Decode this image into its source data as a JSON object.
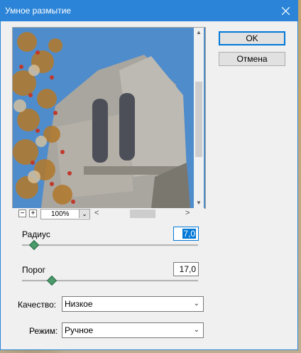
{
  "window": {
    "title": "Умное размытие"
  },
  "buttons": {
    "ok": "OK",
    "cancel": "Отмена"
  },
  "preview": {
    "zoom": "100%",
    "zoom_minus": "−",
    "zoom_plus": "+"
  },
  "radius": {
    "label": "Радиус",
    "value": "7,0",
    "slider_fraction": 0.07
  },
  "threshold": {
    "label": "Порог",
    "value": "17,0",
    "slider_fraction": 0.17
  },
  "quality": {
    "label": "Качество:",
    "selected": "Низкое"
  },
  "mode": {
    "label": "Режим:",
    "selected": "Ручное"
  },
  "colors": {
    "accent": "#2b84d8",
    "selection": "#0078d7",
    "slider_thumb": "#4a9a6a"
  }
}
